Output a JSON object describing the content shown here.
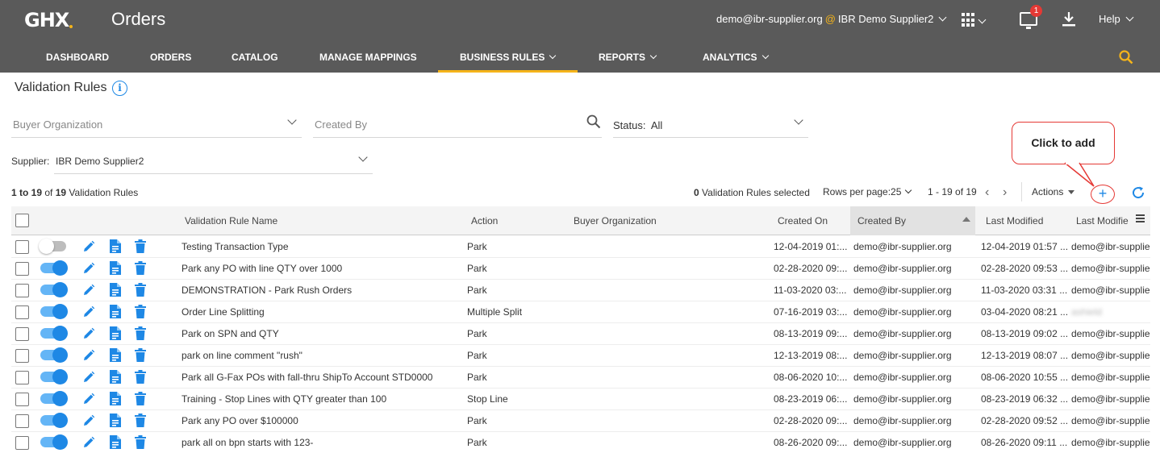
{
  "header": {
    "logo": "GHX",
    "app_title": "Orders",
    "user_email": "demo@ibr-supplier.org",
    "at_symbol": "@",
    "org_name": "IBR Demo Supplier2",
    "notification_count": "1",
    "help_label": "Help",
    "accent_color": "#f5b41a"
  },
  "nav": {
    "items": [
      {
        "label": "DASHBOARD",
        "has_dropdown": false
      },
      {
        "label": "ORDERS",
        "has_dropdown": false
      },
      {
        "label": "CATALOG",
        "has_dropdown": false
      },
      {
        "label": "MANAGE MAPPINGS",
        "has_dropdown": false
      },
      {
        "label": "BUSINESS RULES",
        "has_dropdown": true,
        "active": true
      },
      {
        "label": "REPORTS",
        "has_dropdown": true
      },
      {
        "label": "ANALYTICS",
        "has_dropdown": true
      }
    ]
  },
  "page": {
    "title": "Validation Rules",
    "info_symbol": "i"
  },
  "filters": {
    "buyer_org_placeholder": "Buyer Organization",
    "created_by_placeholder": "Created By",
    "status_label": "Status:",
    "status_value": "All",
    "supplier_label": "Supplier:",
    "supplier_value": "IBR Demo Supplier2"
  },
  "toolbar": {
    "summary_range": "1 to 19",
    "summary_of": "of",
    "summary_total": "19",
    "summary_suffix": "Validation Rules",
    "selected_count": "0",
    "selected_suffix": "Validation Rules selected",
    "rows_per_page_label": "Rows per page:",
    "rows_per_page_value": "25",
    "range_text": "1 - 19 of 19",
    "prev_symbol": "‹",
    "next_symbol": "›",
    "actions_label": "Actions",
    "add_symbol": "+"
  },
  "callout": {
    "text": "Click to add"
  },
  "table": {
    "columns": {
      "name": "Validation Rule Name",
      "action": "Action",
      "buyer": "Buyer Organization",
      "created_on": "Created On",
      "created_by": "Created By",
      "last_modified": "Last Modified",
      "last_modified_by": "Last Modifie"
    },
    "sorted_column": "created_by",
    "rows": [
      {
        "enabled": false,
        "name": "Testing Transaction Type",
        "action": "Park",
        "buyer": "",
        "created_on": "12-04-2019 01:...",
        "created_by": "demo@ibr-supplier.org",
        "last_modified": "12-04-2019 01:57 ...",
        "last_modified_by": "demo@ibr-supplier"
      },
      {
        "enabled": true,
        "name": "Park any PO with line QTY over 1000",
        "action": "Park",
        "buyer": "",
        "created_on": "02-28-2020 09:...",
        "created_by": "demo@ibr-supplier.org",
        "last_modified": "02-28-2020 09:53 ...",
        "last_modified_by": "demo@ibr-supplier"
      },
      {
        "enabled": true,
        "name": "DEMONSTRATION - Park Rush Orders",
        "action": "Park",
        "buyer": "",
        "created_on": "11-03-2020 03:...",
        "created_by": "demo@ibr-supplier.org",
        "last_modified": "11-03-2020 03:31 ...",
        "last_modified_by": "demo@ibr-supplier"
      },
      {
        "enabled": true,
        "name": "Order Line Splitting",
        "action": "Multiple Split",
        "buyer": "",
        "created_on": "07-16-2019 03:...",
        "created_by": "demo@ibr-supplier.org",
        "last_modified": "03-04-2020 08:21 ...",
        "last_modified_by": "ashield",
        "blurred": true
      },
      {
        "enabled": true,
        "name": "Park on SPN and QTY",
        "action": "Park",
        "buyer": "",
        "created_on": "08-13-2019 09:...",
        "created_by": "demo@ibr-supplier.org",
        "last_modified": "08-13-2019 09:02 ...",
        "last_modified_by": "demo@ibr-supplier"
      },
      {
        "enabled": true,
        "name": "park on line comment \"rush\"",
        "action": "Park",
        "buyer": "",
        "created_on": "12-13-2019 08:...",
        "created_by": "demo@ibr-supplier.org",
        "last_modified": "12-13-2019 08:07 ...",
        "last_modified_by": "demo@ibr-supplier"
      },
      {
        "enabled": true,
        "name": "Park all G-Fax POs with fall-thru ShipTo Account STD0000",
        "action": "Park",
        "buyer": "",
        "created_on": "08-06-2020 10:...",
        "created_by": "demo@ibr-supplier.org",
        "last_modified": "08-06-2020 10:55 ...",
        "last_modified_by": "demo@ibr-supplier"
      },
      {
        "enabled": true,
        "name": "Training - Stop Lines with QTY greater than 100",
        "action": "Stop Line",
        "buyer": "",
        "created_on": "08-23-2019 06:...",
        "created_by": "demo@ibr-supplier.org",
        "last_modified": "08-23-2019 06:32 ...",
        "last_modified_by": "demo@ibr-supplier"
      },
      {
        "enabled": true,
        "name": "Park any PO over $100000",
        "action": "Park",
        "buyer": "",
        "created_on": "02-28-2020 09:...",
        "created_by": "demo@ibr-supplier.org",
        "last_modified": "02-28-2020 09:52 ...",
        "last_modified_by": "demo@ibr-supplier"
      },
      {
        "enabled": true,
        "name": "park all on bpn starts with 123-",
        "action": "Park",
        "buyer": "",
        "created_on": "08-26-2020 09:...",
        "created_by": "demo@ibr-supplier.org",
        "last_modified": "08-26-2020 09:11 ...",
        "last_modified_by": "demo@ibr-supplier"
      }
    ]
  },
  "colors": {
    "header_bg": "#5a5a5a",
    "accent": "#f5b41a",
    "primary_blue": "#1e88e5",
    "callout_red": "#e53935"
  }
}
